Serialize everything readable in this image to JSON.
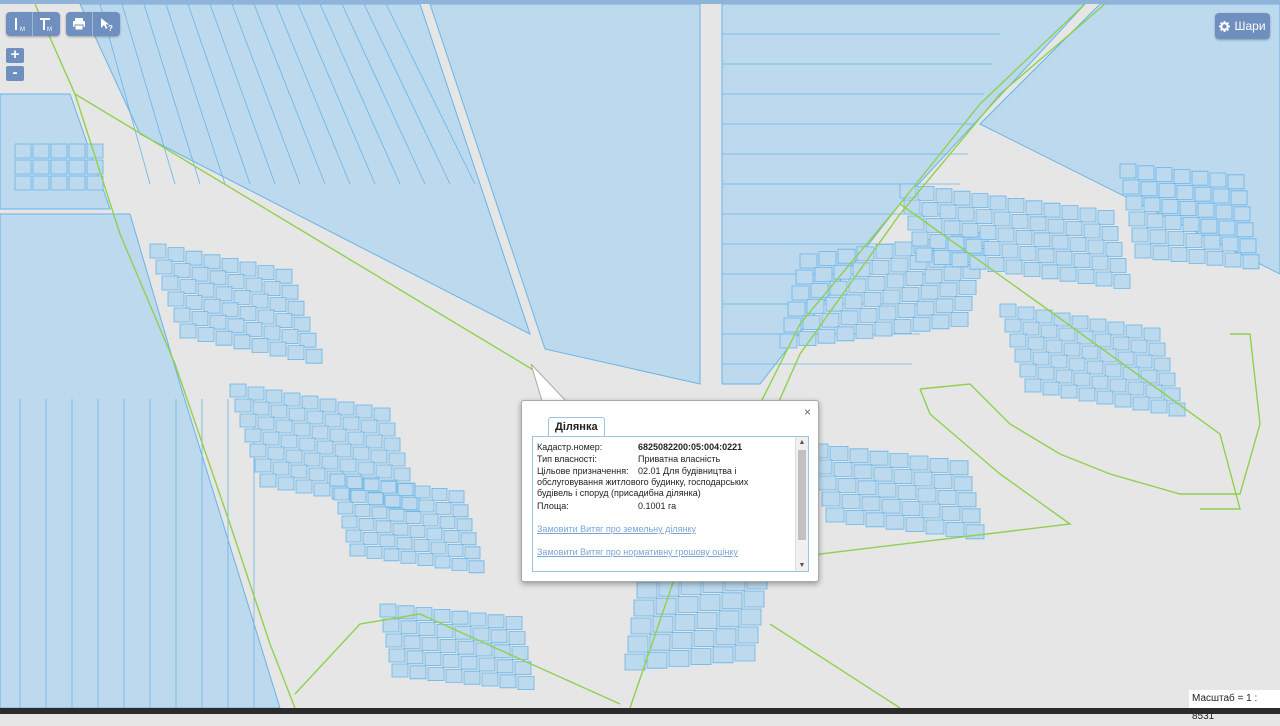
{
  "toolbar": {
    "measure_line_icon": "ruler-line-icon",
    "measure_area_icon": "ruler-area-icon",
    "print_icon": "printer-icon",
    "info_icon": "pointer-help-icon",
    "zoom_in_label": "+",
    "zoom_out_label": "-"
  },
  "layers_button": {
    "label": "Шари",
    "icon": "gear-icon"
  },
  "popup": {
    "tab_label": "Ділянка",
    "close_label": "×",
    "fields": [
      {
        "label": "Кадастр.номер:",
        "value": "6825082200:05:004:0221"
      },
      {
        "label": "Тип власності:",
        "value": "Приватна власність"
      },
      {
        "label": "Цільове призначення:",
        "value": "02.01 Для будівництва і обслуговування житлового будинку, господарських будівель і споруд (присадибна ділянка)"
      },
      {
        "label": "Площа:",
        "value": "0.1001 га"
      }
    ],
    "link1": "Замовити Витяг про земельну ділянку",
    "link2": "Замовити Витяг про нормативну грошову оцінку"
  },
  "scale": {
    "text": "Масштаб = 1 : 8531"
  },
  "colors": {
    "map_bg": "#e6e6e6",
    "parcel_fill": "#bcd9ee",
    "parcel_stroke": "#6ab4e6",
    "boundary": "#8fd14f",
    "ui_button": "#6f8fbf"
  }
}
